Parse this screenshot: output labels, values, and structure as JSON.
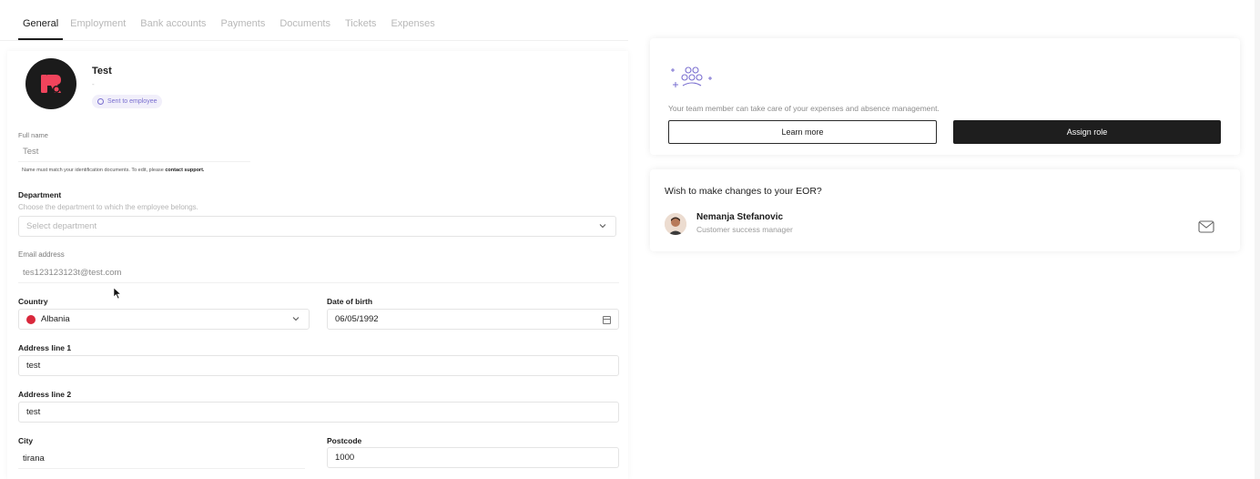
{
  "tabs": [
    {
      "label": "General",
      "active": true
    },
    {
      "label": "Employment",
      "active": false
    },
    {
      "label": "Bank accounts",
      "active": false
    },
    {
      "label": "Payments",
      "active": false
    },
    {
      "label": "Documents",
      "active": false
    },
    {
      "label": "Tickets",
      "active": false
    },
    {
      "label": "Expenses",
      "active": false
    }
  ],
  "profile": {
    "name": "Test",
    "subtitle": "-",
    "status_badge": "Sent to employee",
    "avatar_color": "#1b1b1b",
    "logo_color": "#f0445c"
  },
  "form": {
    "full_name_label": "Full name",
    "full_name_value": "Test",
    "full_name_note": "Name must match your identification documents. To edit, please",
    "full_name_note_link": "contact support.",
    "department_label": "Department",
    "department_hint": "Choose the department to which the employee belongs.",
    "department_placeholder": "Select department",
    "email_label": "Email address",
    "email_value": "tes123123123t@test.com",
    "country_label": "Country",
    "country_value": "Albania",
    "country_flag_color": "#d9283c",
    "dob_label": "Date of birth",
    "dob_value": "06/05/1992",
    "address1_label": "Address line 1",
    "address1_value": "test",
    "address2_label": "Address line 2",
    "address2_value": "test",
    "city_label": "City",
    "city_value": "tirana",
    "postcode_label": "Postcode",
    "postcode_value": "1000"
  },
  "role_card": {
    "icon": "team-icon",
    "text": "Your team member can take care of your expenses and absence management.",
    "learn_more_label": "Learn more",
    "assign_role_label": "Assign role"
  },
  "eor_card": {
    "title": "Wish to make changes to your EOR?",
    "person_name": "Nemanja Stefanovic",
    "person_role": "Customer success manager",
    "contact_icon": "mail-icon"
  }
}
